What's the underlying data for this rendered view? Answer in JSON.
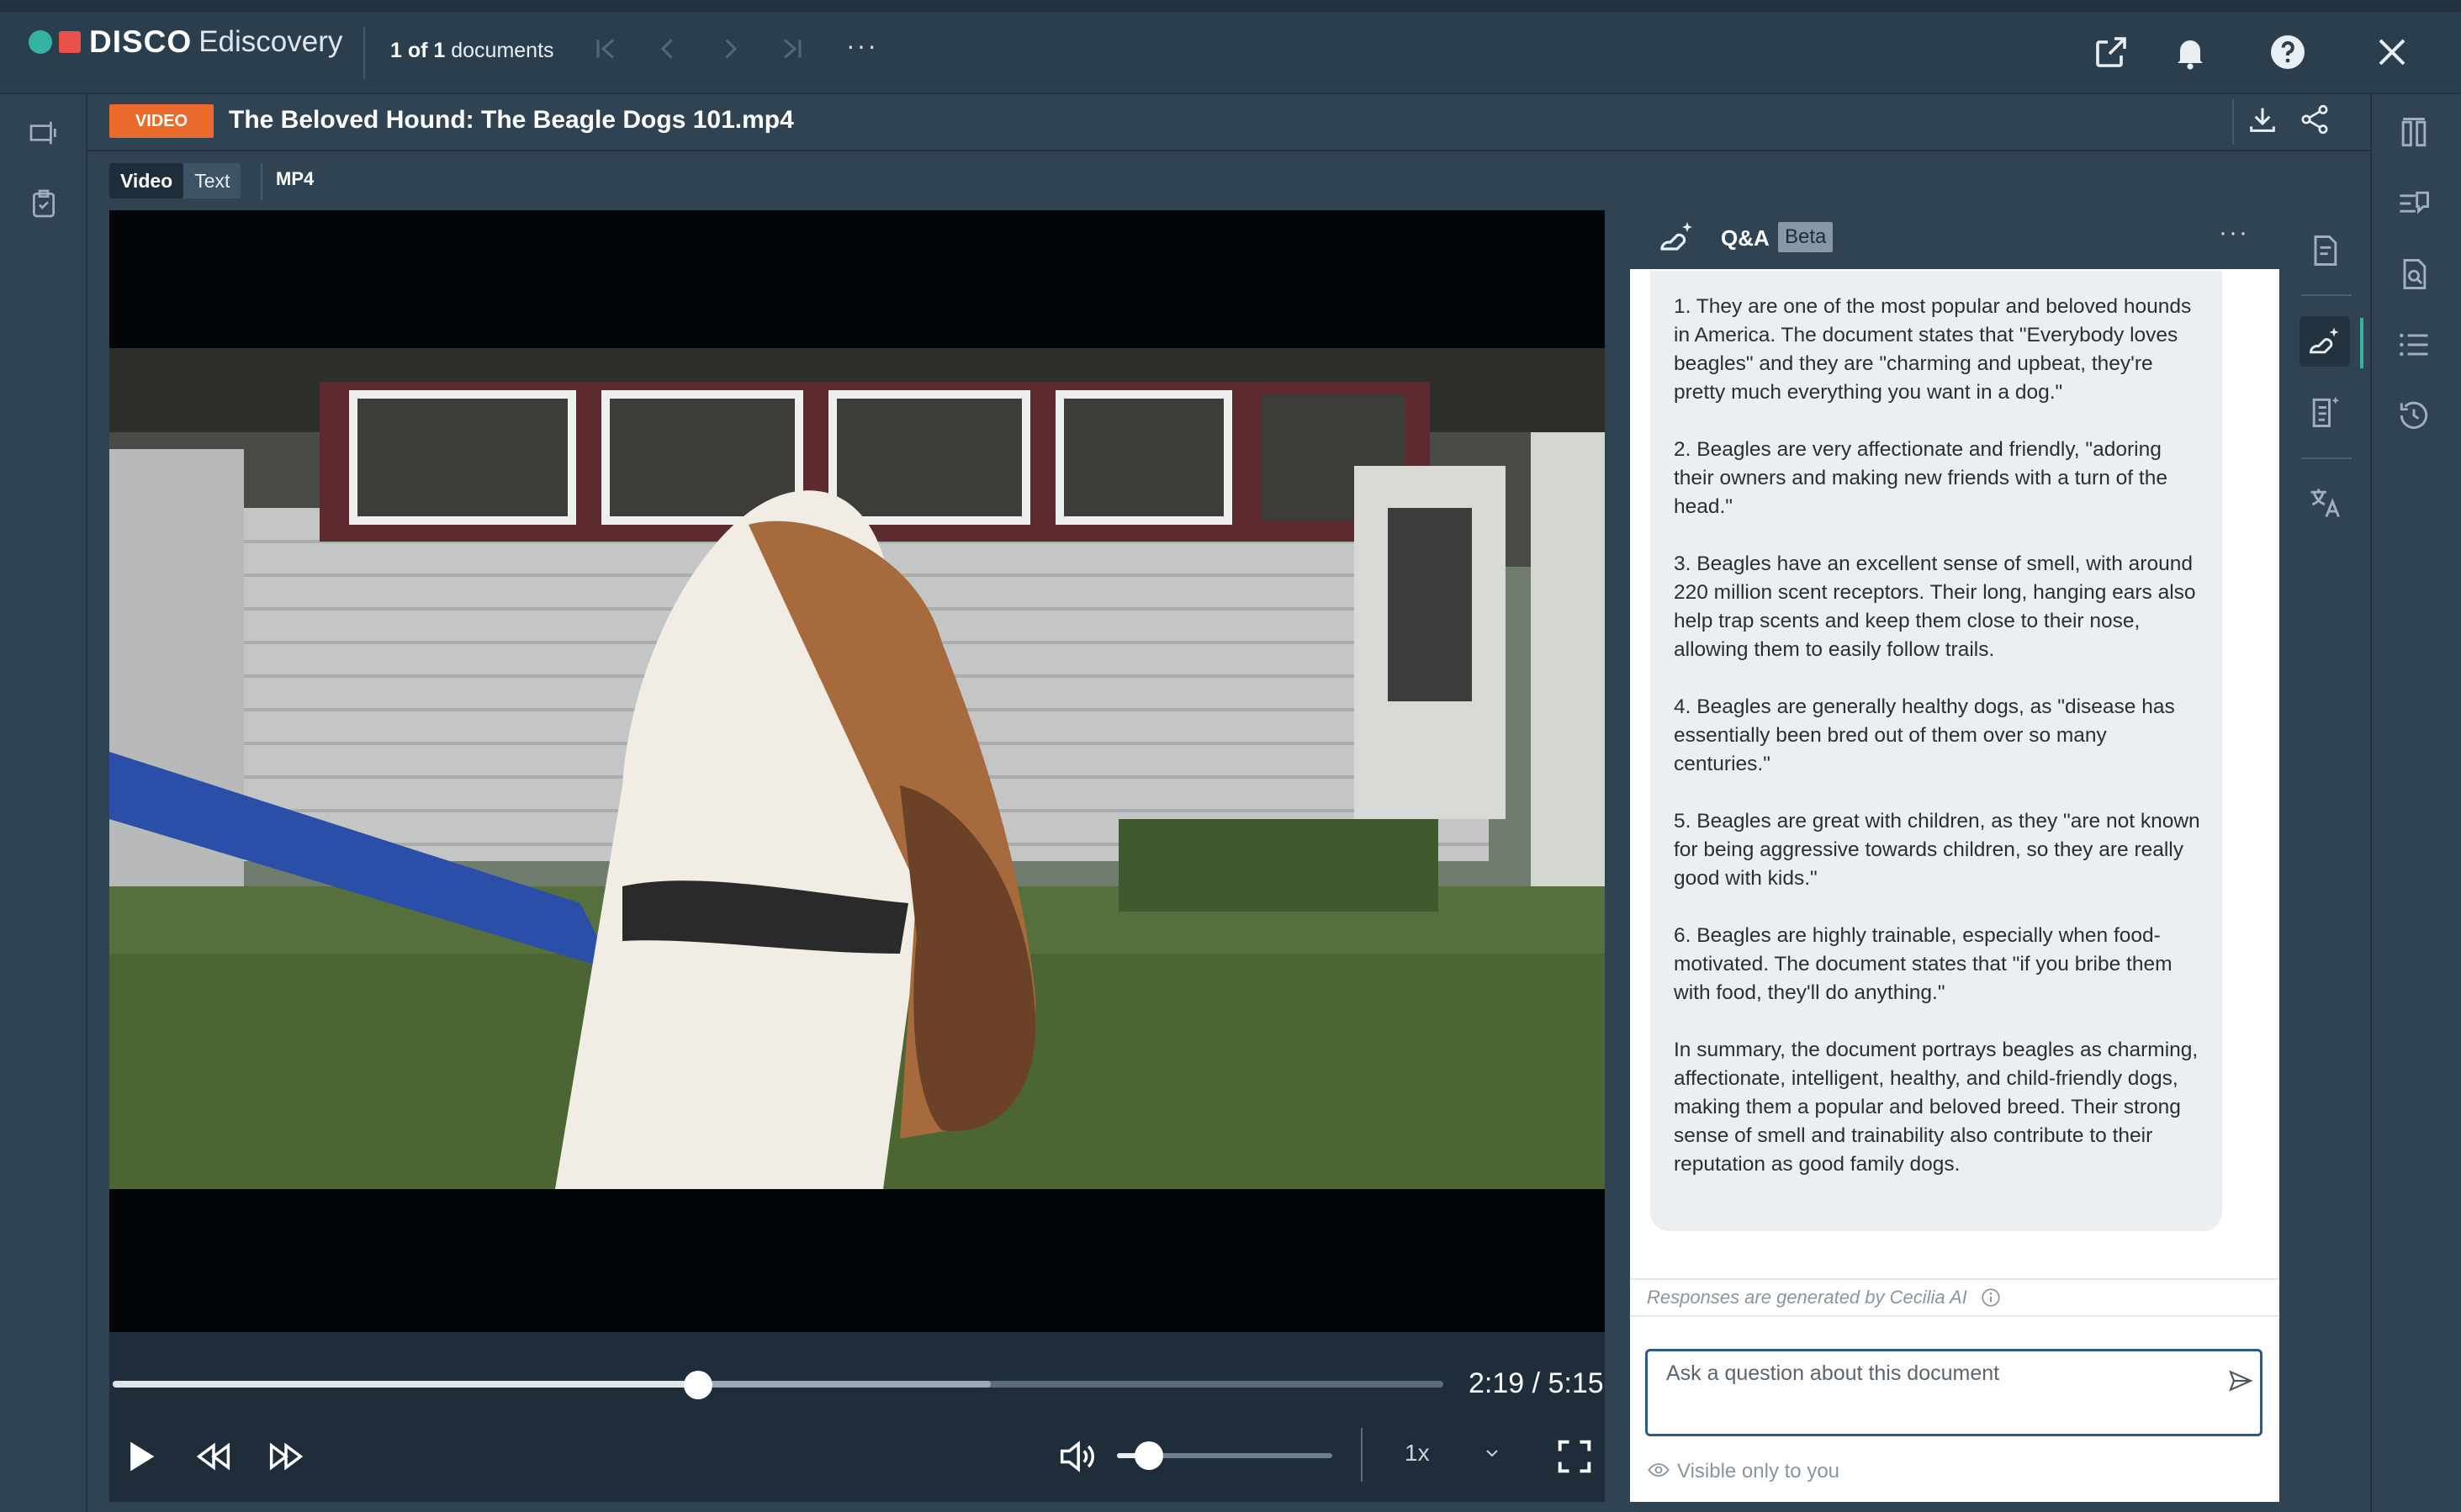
{
  "app": {
    "brand": "DISCO",
    "product": "Ediscovery"
  },
  "navigation": {
    "doc_count_prefix": "1 of 1",
    "doc_count_suffix": " documents",
    "icons": [
      "first-page-icon",
      "previous-page-icon",
      "next-page-icon",
      "last-page-icon"
    ],
    "more": "···"
  },
  "document": {
    "type_badge": "VIDEO",
    "title": "The Beloved Hound: The Beagle Dogs 101.mp4",
    "view_tabs": [
      "Video",
      "Text"
    ],
    "active_tab": "Video",
    "format": "MP4"
  },
  "player": {
    "time": "2:19 / 5:15",
    "progress": 0.44,
    "buffered": 0.66,
    "volume": 0.15,
    "speed": "1x"
  },
  "qa": {
    "title": "Q&A",
    "badge": "Beta",
    "more": "···",
    "answer": [
      "1. They are one of the most popular and beloved hounds in America. The document states that \"Everybody loves beagles\" and they are \"charming and upbeat, they're pretty much everything you want in a dog.\"",
      "2. Beagles are very affectionate and friendly, \"adoring their owners and making new friends with a turn of the head.\"",
      "3. Beagles have an excellent sense of smell, with around 220 million scent receptors. Their long, hanging ears also help trap scents and keep them close to their nose, allowing them to easily follow trails.",
      "4. Beagles are generally healthy dogs, as \"disease has essentially been bred out of them over so many centuries.\"",
      "5. Beagles are great with children, as they \"are not known for being aggressive towards children, so they are really good with kids.\"",
      "6. Beagles are highly trainable, especially when food-motivated. The document states that \"if you bribe them with food, they'll do anything.\"",
      "In summary, the document portrays beagles as charming, affectionate, intelligent, healthy, and child-friendly dogs, making them a popular and beloved breed. Their strong sense of smell and trainability also contribute to their reputation as good family dogs."
    ],
    "disclaimer": "Responses are generated by Cecilia AI",
    "input_placeholder": "Ask a question about this document",
    "input_value": "",
    "visibility": "Visible only to you"
  },
  "colors": {
    "accent": "#34b3a4",
    "video_badge": "#ea6a2b",
    "brand_red": "#e8514a",
    "panel_bg": "#2f4353"
  }
}
